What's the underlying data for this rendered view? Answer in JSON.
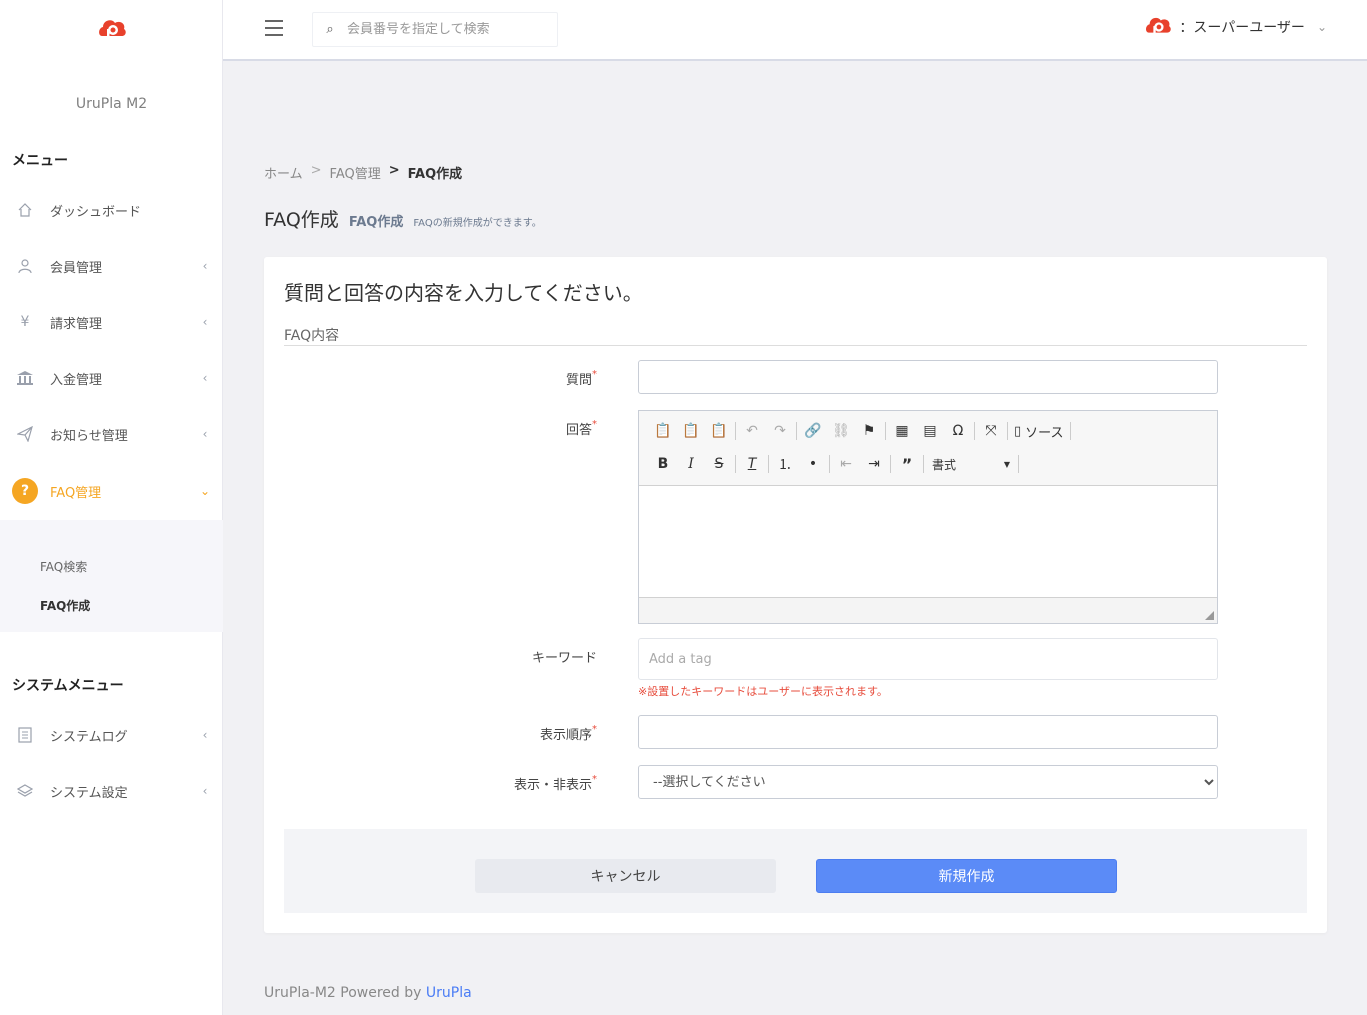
{
  "app": {
    "name": "UruPla M2"
  },
  "header": {
    "search_placeholder": "会員番号を指定して検索",
    "user_label": "：スーパーユーザー"
  },
  "sidebar": {
    "menu_heading": "メニュー",
    "items": [
      {
        "label": "ダッシュボード",
        "icon": "home-icon"
      },
      {
        "label": "会員管理",
        "icon": "user-icon"
      },
      {
        "label": "請求管理",
        "icon": "yen-icon"
      },
      {
        "label": "入金管理",
        "icon": "bank-icon"
      },
      {
        "label": "お知らせ管理",
        "icon": "send-icon"
      },
      {
        "label": "FAQ管理",
        "icon": "question-icon",
        "active": true
      }
    ],
    "faq_sub": [
      {
        "label": "FAQ検索"
      },
      {
        "label": "FAQ作成",
        "current": true
      }
    ],
    "system_heading": "システムメニュー",
    "system_items": [
      {
        "label": "システムログ",
        "icon": "document-icon"
      },
      {
        "label": "システム設定",
        "icon": "layers-icon"
      }
    ]
  },
  "breadcrumb": {
    "home": "ホーム",
    "parent": "FAQ管理",
    "current": "FAQ作成",
    "sep1": ">",
    "sep2": ">"
  },
  "page": {
    "title": "FAQ作成",
    "subtitle": "FAQ作成",
    "description": "FAQの新規作成ができます。"
  },
  "form": {
    "heading": "質問と回答の内容を入力してください。",
    "section": "FAQ内容",
    "question_label": "質問",
    "answer_label": "回答",
    "keyword_label": "キーワード",
    "keyword_placeholder": "Add a tag",
    "keyword_note": "※設置したキーワードはユーザーに表示されます。",
    "order_label": "表示順序",
    "visibility_label": "表示・非表示",
    "visibility_selected": "--選択してください",
    "required_mark": "*"
  },
  "editor": {
    "source_label": "ソース",
    "format_label": "書式"
  },
  "buttons": {
    "cancel": "キャンセル",
    "create": "新規作成"
  },
  "footer": {
    "prefix": "UruPla-M2 Powered by ",
    "link": "UruPla"
  },
  "colors": {
    "accent": "#f5a623",
    "primary": "#5b8bf7",
    "danger": "#e74c3c",
    "logo": "#e8412c"
  }
}
